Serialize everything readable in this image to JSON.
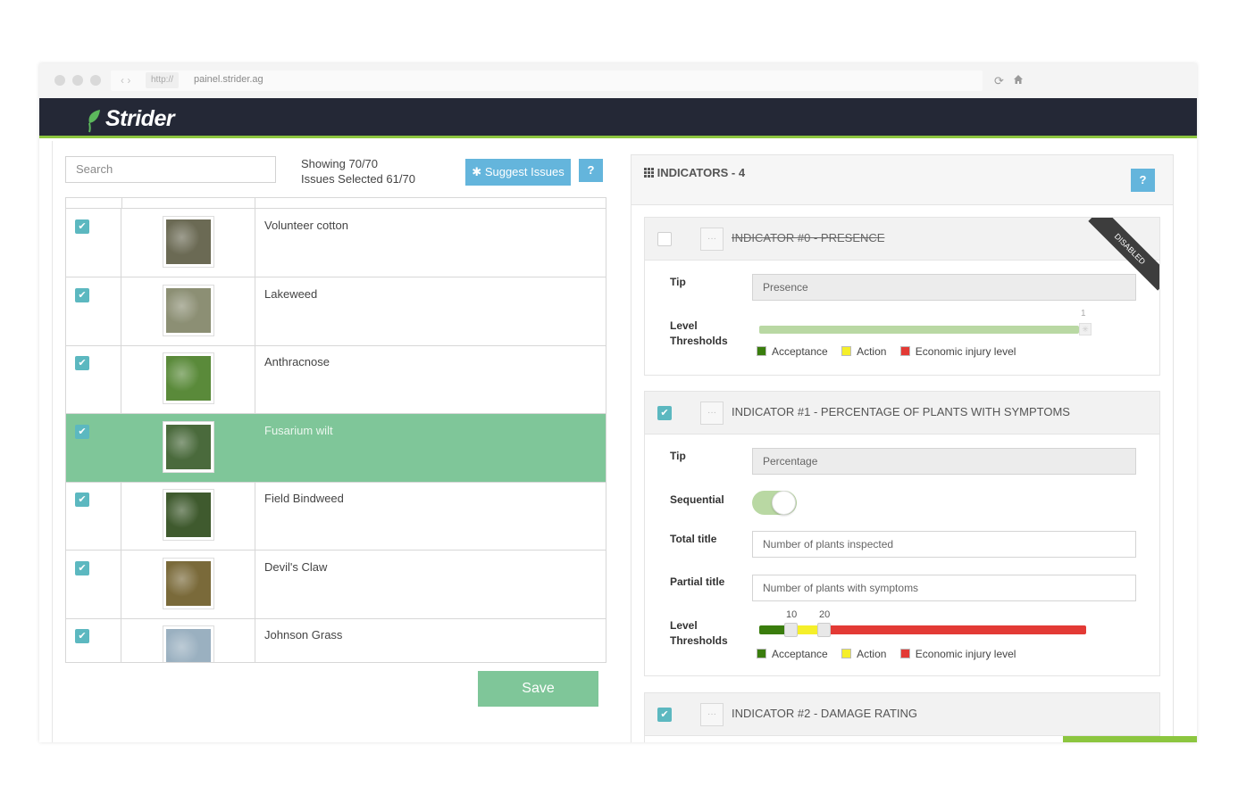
{
  "browser": {
    "protocol": "http://",
    "url": "painel.strider.ag",
    "nav_arrows": "‹ ›"
  },
  "app": {
    "brand": "Strider"
  },
  "toolbar": {
    "search_placeholder": "Search",
    "showing_text": "Showing 70/70",
    "selected_text": "Issues Selected 61/70",
    "suggest_label": "Suggest Issues",
    "help_label": "?"
  },
  "issues": [
    {
      "name": "Volunteer cotton",
      "checked": true,
      "selected": false,
      "thumb_color": "#6b6a54"
    },
    {
      "name": "Lakeweed",
      "checked": true,
      "selected": false,
      "thumb_color": "#8c8f74"
    },
    {
      "name": "Anthracnose",
      "checked": true,
      "selected": false,
      "thumb_color": "#5a8a3a"
    },
    {
      "name": "Fusarium wilt",
      "checked": true,
      "selected": true,
      "thumb_color": "#4a6a3c"
    },
    {
      "name": "Field Bindweed",
      "checked": true,
      "selected": false,
      "thumb_color": "#3f5a2e"
    },
    {
      "name": "Devil's Claw",
      "checked": true,
      "selected": false,
      "thumb_color": "#7a6a3a"
    },
    {
      "name": "Johnson Grass",
      "checked": true,
      "selected": false,
      "thumb_color": "#9ab0c0"
    }
  ],
  "save_label": "Save",
  "indicators": {
    "title": "INDICATORS - 4",
    "help_label": "?",
    "items": [
      {
        "title": "INDICATOR #0 - PRESENCE",
        "enabled": false,
        "ribbon": "DISABLED",
        "tip_label": "Tip",
        "tip_value": "Presence",
        "level_label": "Level Thresholds",
        "threshold_max": "1"
      },
      {
        "title": "INDICATOR #1 - PERCENTAGE OF PLANTS WITH SYMPTOMS",
        "enabled": true,
        "tip_label": "Tip",
        "tip_value": "Percentage",
        "sequential_label": "Sequential",
        "sequential_on": true,
        "total_label": "Total title",
        "total_value": "Number of plants inspected",
        "partial_label": "Partial title",
        "partial_value": "Number of plants with symptoms",
        "level_label": "Level Thresholds",
        "threshold_low": "10",
        "threshold_high": "20"
      },
      {
        "title": "INDICATOR #2 - DAMAGE RATING",
        "enabled": true
      }
    ],
    "legend": {
      "acceptance": "Acceptance",
      "action": "Action",
      "economic": "Economic injury level"
    }
  },
  "colors": {
    "accent_green": "#8cc63f",
    "selected_row": "#7fc699",
    "button_blue": "#64b5dc",
    "checkbox": "#5cb8c0",
    "acceptance": "#3a7d0d",
    "action": "#f5ef2a",
    "economic": "#e33a35",
    "header_bg": "#242836"
  },
  "icons": [
    "leaf-logo-icon",
    "bug-icon",
    "grid-icon",
    "reload-icon",
    "home-icon",
    "check-icon",
    "drag-handle-icon"
  ]
}
